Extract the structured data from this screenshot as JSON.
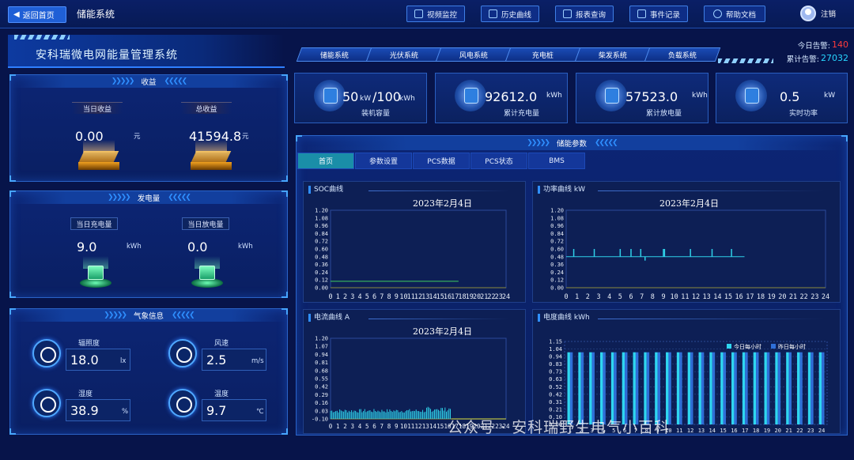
{
  "header": {
    "back_label": "返回首页",
    "system_name": "储能系统",
    "nav": [
      {
        "label": "视频监控",
        "icon": "video-icon"
      },
      {
        "label": "历史曲线",
        "icon": "history-icon"
      },
      {
        "label": "报表查询",
        "icon": "report-search-icon"
      },
      {
        "label": "事件记录",
        "icon": "event-log-icon"
      },
      {
        "label": "帮助文档",
        "icon": "help-icon"
      }
    ],
    "logout_label": "注销"
  },
  "brand": {
    "title": "安科瑞微电网能量管理系统"
  },
  "subtabs": [
    "储能系统",
    "光伏系统",
    "风电系统",
    "充电桩",
    "柴发系统",
    "负载系统"
  ],
  "alarms": {
    "today_label": "今日告警:",
    "today_value": "140",
    "total_label": "累计告警:",
    "total_value": "27032"
  },
  "revenue": {
    "title": "收益",
    "today_label": "当日收益",
    "today_value": "0.00",
    "today_unit": "元",
    "total_label": "总收益",
    "total_value": "41594.8",
    "total_unit": "元"
  },
  "energy": {
    "title": "发电量",
    "charge_label": "当日充电量",
    "charge_value": "9.0",
    "charge_unit": "kWh",
    "discharge_label": "当日放电量",
    "discharge_value": "0.0",
    "discharge_unit": "kWh"
  },
  "weather": {
    "title": "气象信息",
    "irradiance_label": "辐照度",
    "irradiance_value": "18.0",
    "irradiance_unit": "lx",
    "wind_label": "风速",
    "wind_value": "2.5",
    "wind_unit": "m/s",
    "humidity_label": "湿度",
    "humidity_value": "38.9",
    "humidity_unit": "%",
    "temperature_label": "温度",
    "temperature_value": "9.7",
    "temperature_unit": "℃"
  },
  "stats": [
    {
      "value": "50",
      "unit": "kW",
      "value2": "/100",
      "unit2": "kWh",
      "label": "装机容量"
    },
    {
      "value": "92612.0",
      "unit": "kWh",
      "label": "累计充电量"
    },
    {
      "value": "57523.0",
      "unit": "kWh",
      "label": "累计放电量"
    },
    {
      "value": "0.5",
      "unit": "kW",
      "label": "实时功率"
    }
  ],
  "params": {
    "title": "储能参数",
    "tabs": [
      "首页",
      "参数设置",
      "PCS数据",
      "PCS状态",
      "BMS"
    ]
  },
  "chart_data": [
    {
      "type": "line",
      "title": "SOC曲线",
      "subtitle": "2023年2月4日",
      "x_ticks": [
        "0",
        "1",
        "2",
        "3",
        "4",
        "5",
        "6",
        "7",
        "8",
        "9",
        "10",
        "11",
        "12",
        "13",
        "14",
        "15",
        "16",
        "17",
        "18",
        "19",
        "20",
        "21",
        "22",
        "23",
        "24"
      ],
      "y_ticks": [
        "0.00",
        "0.12",
        "0.24",
        "0.36",
        "0.48",
        "0.60",
        "0.72",
        "0.84",
        "0.96",
        "1.08",
        "1.20"
      ],
      "ylim": [
        0,
        1.2
      ],
      "xlim": [
        0,
        24
      ],
      "series": [
        {
          "x": [
            0,
            17.5
          ],
          "y": [
            0.1,
            0.1
          ],
          "color": "#3fcf5f"
        }
      ]
    },
    {
      "type": "line",
      "title": "功率曲线  kW",
      "subtitle": "2023年2月4日",
      "x_ticks": [
        "0",
        "1",
        "2",
        "3",
        "4",
        "5",
        "6",
        "7",
        "8",
        "9",
        "10",
        "11",
        "12",
        "13",
        "14",
        "15",
        "16",
        "17",
        "18",
        "19",
        "20",
        "21",
        "22",
        "23",
        "24"
      ],
      "y_ticks": [
        "0.00",
        "0.12",
        "0.24",
        "0.36",
        "0.48",
        "0.60",
        "0.72",
        "0.84",
        "0.96",
        "1.08",
        "1.20"
      ],
      "ylim": [
        0,
        1.2
      ],
      "xlim": [
        0,
        24
      ],
      "baseline": 0.48,
      "spikes": [
        {
          "x": 0.7,
          "y": 0.6
        },
        {
          "x": 2.6,
          "y": 0.6
        },
        {
          "x": 5.0,
          "y": 0.6
        },
        {
          "x": 6.0,
          "y": 0.6
        },
        {
          "x": 6.9,
          "y": 0.6
        },
        {
          "x": 7.3,
          "y": 0.42
        },
        {
          "x": 9.0,
          "y": 0.6
        },
        {
          "x": 9.1,
          "y": 0.6
        },
        {
          "x": 11.5,
          "y": 0.6
        },
        {
          "x": 13.5,
          "y": 0.6
        },
        {
          "x": 15.3,
          "y": 0.6
        }
      ],
      "color": "#2fd0e8",
      "x_end": 16.5
    },
    {
      "type": "line",
      "title": "电流曲线  A",
      "subtitle": "2023年2月4日",
      "x_ticks": [
        "0",
        "1",
        "2",
        "3",
        "4",
        "5",
        "6",
        "7",
        "8",
        "9",
        "10",
        "11",
        "12",
        "13",
        "14",
        "15",
        "16",
        "17",
        "18",
        "19",
        "20",
        "21",
        "22",
        "23",
        "24"
      ],
      "y_ticks": [
        "-0.10",
        "0.03",
        "0.16",
        "0.29",
        "0.42",
        "0.55",
        "0.68",
        "0.81",
        "0.94",
        "1.07",
        "1.20"
      ],
      "ylim": [
        -0.1,
        1.2
      ],
      "xlim": [
        0,
        24
      ],
      "color": "#2fd0e8",
      "noise_range": [
        0,
        16.5
      ],
      "noise_level": [
        0.0,
        0.06
      ],
      "tail": {
        "x": [
          16.5,
          24
        ],
        "y": [
          -0.1,
          -0.1
        ],
        "color": "#e0e040"
      }
    },
    {
      "type": "bar",
      "title": "电度曲线  kWh",
      "categories": [
        "1",
        "2",
        "3",
        "4",
        "5",
        "6",
        "7",
        "8",
        "9",
        "10",
        "11",
        "12",
        "13",
        "14",
        "15",
        "16",
        "17",
        "18",
        "19",
        "20",
        "21",
        "22",
        "23",
        "24"
      ],
      "y_ticks": [
        "0.00",
        "0.10",
        "0.21",
        "0.31",
        "0.42",
        "0.52",
        "0.63",
        "0.73",
        "0.83",
        "0.94",
        "1.04",
        "1.15"
      ],
      "ylim": [
        0,
        1.15
      ],
      "series": [
        {
          "name": "今日每小时",
          "color": "#2fd6f0",
          "values": [
            1.0,
            1.0,
            1.0,
            1.0,
            1.0,
            1.0,
            1.0,
            1.0,
            1.0,
            1.0,
            1.0,
            1.0,
            1.0,
            1.0,
            1.0,
            1.0,
            1.0,
            1.0,
            1.0,
            1.0,
            1.0,
            1.0,
            1.0,
            1.0
          ]
        },
        {
          "name": "昨日每小时",
          "color": "#2f6fd8",
          "values": [
            1.0,
            1.0,
            1.0,
            1.0,
            1.0,
            1.0,
            1.0,
            1.0,
            1.0,
            1.0,
            1.0,
            1.0,
            1.0,
            1.0,
            1.0,
            1.0,
            1.0,
            1.0,
            1.0,
            1.0,
            1.0,
            1.0,
            1.0,
            1.0
          ]
        }
      ]
    }
  ],
  "watermark": "公众号 · 安科瑞野生电气小百科"
}
